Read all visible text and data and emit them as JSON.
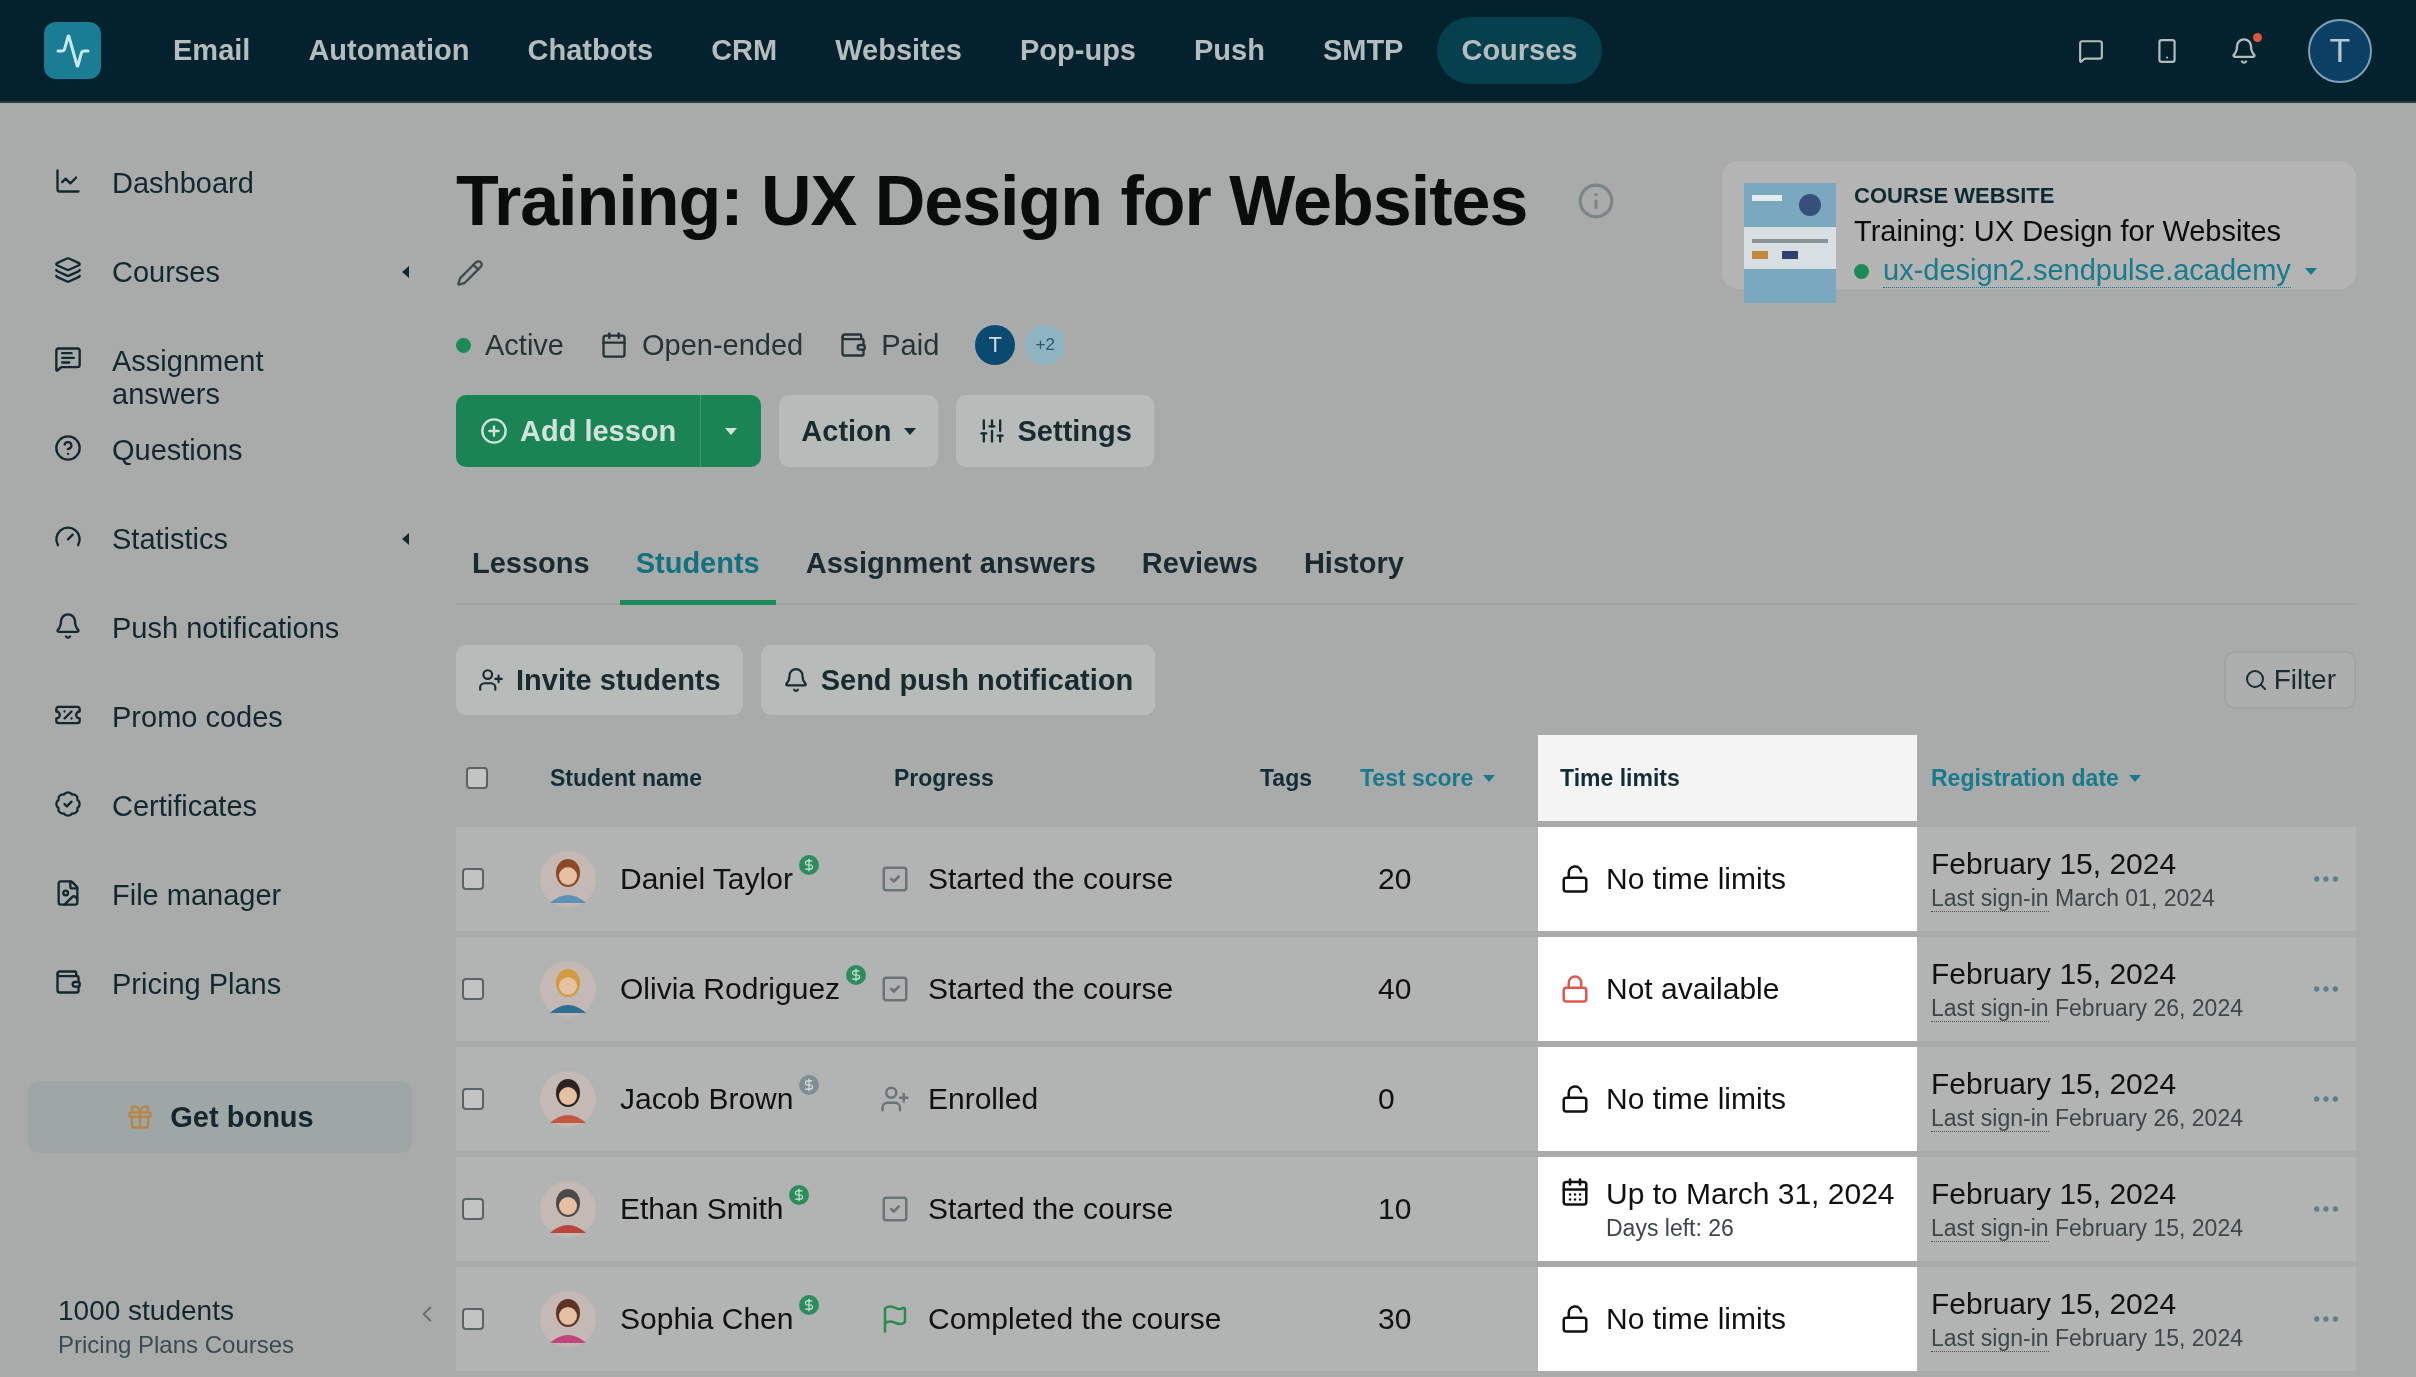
{
  "top_nav": {
    "items": [
      {
        "label": "Email",
        "selected": false
      },
      {
        "label": "Automation",
        "selected": false
      },
      {
        "label": "Chatbots",
        "selected": false
      },
      {
        "label": "CRM",
        "selected": false
      },
      {
        "label": "Websites",
        "selected": false
      },
      {
        "label": "Pop-ups",
        "selected": false
      },
      {
        "label": "Push",
        "selected": false
      },
      {
        "label": "SMTP",
        "selected": false
      },
      {
        "label": "Courses",
        "selected": true
      }
    ],
    "notifications_unread": true,
    "avatar": "T"
  },
  "sidebar": {
    "items": [
      {
        "label": "Dashboard",
        "expandable": false
      },
      {
        "label": "Courses",
        "expandable": true
      },
      {
        "label": "Assignment answers",
        "expandable": false
      },
      {
        "label": "Questions",
        "expandable": false
      },
      {
        "label": "Statistics",
        "expandable": true
      },
      {
        "label": "Push notifications",
        "expandable": false
      },
      {
        "label": "Promo codes",
        "expandable": false
      },
      {
        "label": "Certificates",
        "expandable": false
      },
      {
        "label": "File manager",
        "expandable": false
      },
      {
        "label": "Pricing Plans",
        "expandable": false
      }
    ],
    "bonus_button": "Get bonus",
    "plan_count": "1000 students",
    "plan_name": "Pricing Plans Courses"
  },
  "course": {
    "title": "Training: UX Design for Websites",
    "status": "Active",
    "duration": "Open-ended",
    "access": "Paid",
    "members": [
      "T",
      "+2"
    ],
    "buttons": {
      "add": "Add lesson",
      "action": "Action",
      "settings": "Settings"
    }
  },
  "website_card": {
    "heading": "COURSE WEBSITE",
    "title": "Training: UX Design for Websites",
    "url": "ux-design2.sendpulse.academy",
    "online": true
  },
  "tabs": [
    {
      "label": "Lessons",
      "selected": false
    },
    {
      "label": "Students",
      "selected": true
    },
    {
      "label": "Assignment answers",
      "selected": false
    },
    {
      "label": "Reviews",
      "selected": false
    },
    {
      "label": "History",
      "selected": false
    }
  ],
  "toolbar": {
    "invite": "Invite students",
    "push": "Send push notification",
    "filter": "Filter"
  },
  "table": {
    "select_all": {
      "checked": false
    },
    "columns": [
      {
        "label": "Student name",
        "sortable": false,
        "highlighted": false
      },
      {
        "label": "Progress",
        "sortable": false,
        "highlighted": false
      },
      {
        "label": "Tags",
        "sortable": false,
        "highlighted": false
      },
      {
        "label": "Test score",
        "sortable": true,
        "highlighted": false
      },
      {
        "label": "Time limits",
        "sortable": false,
        "highlighted": true
      },
      {
        "label": "Registration date",
        "sortable": true,
        "highlighted": false
      }
    ],
    "rows": [
      {
        "checked": false,
        "name": "Daniel Taylor",
        "paid": true,
        "progress": {
          "kind": "started",
          "text": "Started the course"
        },
        "score": "20",
        "time_limit": {
          "kind": "none",
          "text": "No time limits"
        },
        "registered": "February 15, 2024",
        "signin_label": "Last sign-in",
        "signin": "March 01, 2024"
      },
      {
        "checked": false,
        "name": "Olivia Rodriguez",
        "paid": true,
        "progress": {
          "kind": "started",
          "text": "Started the course"
        },
        "score": "40",
        "time_limit": {
          "kind": "unavailable",
          "text": "Not available"
        },
        "registered": "February 15, 2024",
        "signin_label": "Last sign-in",
        "signin": "February 26, 2024"
      },
      {
        "checked": false,
        "name": "Jacob Brown",
        "paid": false,
        "progress": {
          "kind": "enrolled",
          "text": "Enrolled"
        },
        "score": "0",
        "time_limit": {
          "kind": "none",
          "text": "No time limits"
        },
        "registered": "February 15, 2024",
        "signin_label": "Last sign-in",
        "signin": "February 26, 2024"
      },
      {
        "checked": false,
        "name": "Ethan Smith",
        "paid": true,
        "progress": {
          "kind": "started",
          "text": "Started the course"
        },
        "score": "10",
        "time_limit": {
          "kind": "until",
          "text": "Up to March 31, 2024",
          "note": "Days left: 26"
        },
        "registered": "February 15, 2024",
        "signin_label": "Last sign-in",
        "signin": "February 15, 2024"
      },
      {
        "checked": false,
        "name": "Sophia Chen",
        "paid": true,
        "progress": {
          "kind": "completed",
          "text": "Completed the course"
        },
        "score": "30",
        "time_limit": {
          "kind": "none",
          "text": "No time limits"
        },
        "registered": "February 15, 2024",
        "signin_label": "Last sign-in",
        "signin": "February 15, 2024"
      }
    ]
  }
}
